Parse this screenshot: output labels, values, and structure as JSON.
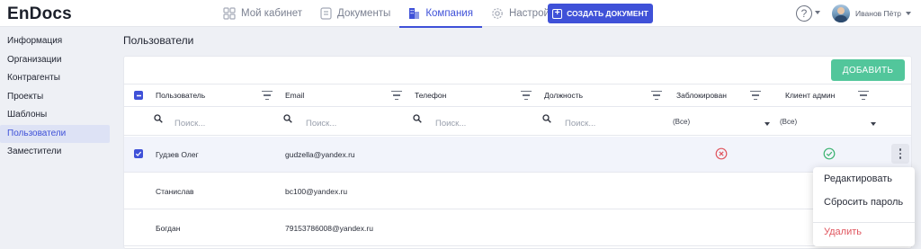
{
  "app": {
    "logo": "EnDocs"
  },
  "nav": {
    "items": [
      {
        "label": "Мой кабинет",
        "icon": "grid-icon"
      },
      {
        "label": "Документы",
        "icon": "document-icon"
      },
      {
        "label": "Компания",
        "icon": "building-icon",
        "active": true
      },
      {
        "label": "Настройки",
        "icon": "gear-icon"
      }
    ],
    "create_label": "СОЗДАТЬ ДОКУМЕНТ"
  },
  "header": {
    "help_symbol": "?",
    "user_name": "Иванов Пётр"
  },
  "sidebar": {
    "items": [
      {
        "label": "Информация"
      },
      {
        "label": "Организации"
      },
      {
        "label": "Контрагенты"
      },
      {
        "label": "Проекты"
      },
      {
        "label": "Шаблоны"
      },
      {
        "label": "Пользователи",
        "active": true
      },
      {
        "label": "Заместители"
      }
    ]
  },
  "main": {
    "title": "Пользователи",
    "add_label": "ДОБАВИТЬ",
    "columns": [
      "Пользователь",
      "Email",
      "Телефон",
      "Должность",
      "Заблокирован",
      "Клиент админ"
    ],
    "search_placeholder": "Поиск...",
    "filters": {
      "blocked": "(Все)",
      "client_admin": "(Все)"
    },
    "rows": [
      {
        "user": "Гудзев Олег",
        "email": "gudzella@yandex.ru",
        "selected": true,
        "blocked": true,
        "client_admin": true
      },
      {
        "user": "Станислав",
        "email": "bc100@yandex.ru",
        "selected": false
      },
      {
        "user": "Богдан",
        "email": "79153786008@yandex.ru",
        "selected": false
      }
    ]
  },
  "context_menu": {
    "items": [
      {
        "label": "Редактировать"
      },
      {
        "label": "Сбросить пароль"
      },
      {
        "label": "Удалить"
      }
    ]
  },
  "colors": {
    "accent": "#3f51d8",
    "add_button": "#52c69b",
    "danger": "#e0565f",
    "success": "#3cb371"
  }
}
